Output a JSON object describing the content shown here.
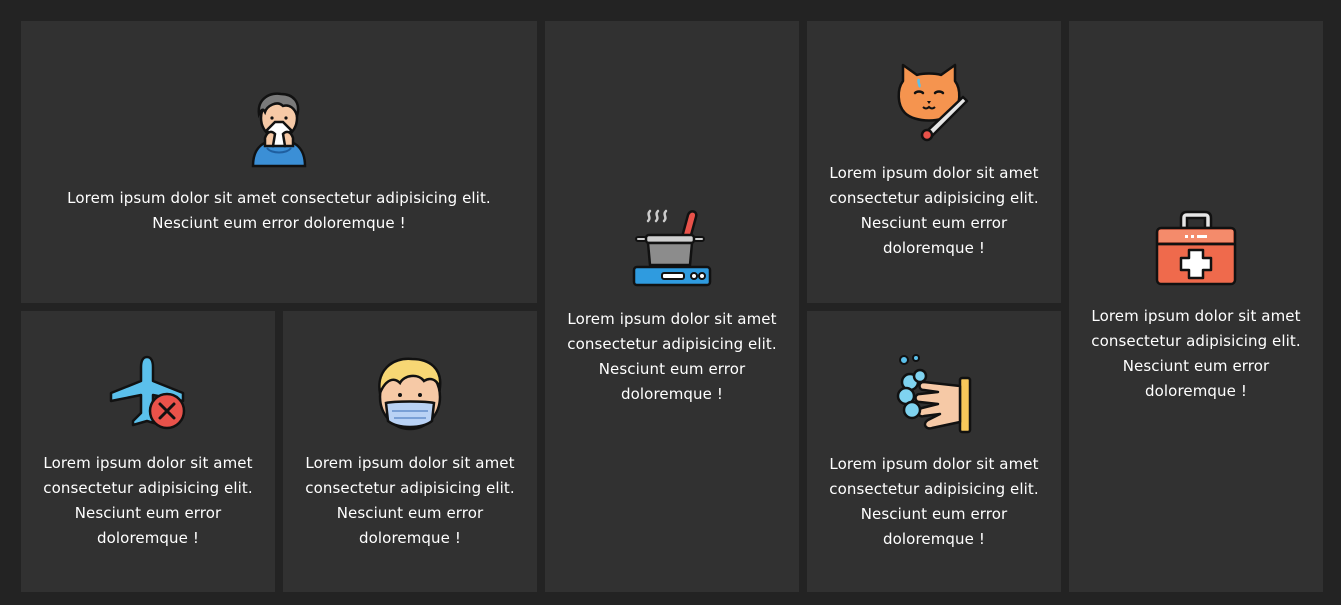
{
  "cards": [
    {
      "id": "sneeze",
      "icon": "sneezing-person-icon",
      "text": "Lorem ipsum dolor sit amet consectetur adipisicing elit. Nesciunt eum error doloremque !"
    },
    {
      "id": "plane",
      "icon": "cancelled-flight-icon",
      "text": "Lorem ipsum dolor sit amet consectetur adipisicing elit. Nesciunt eum error doloremque !"
    },
    {
      "id": "mask",
      "icon": "face-mask-person-icon",
      "text": "Lorem ipsum dolor sit amet consectetur adipisicing elit. Nesciunt eum error doloremque !"
    },
    {
      "id": "cook",
      "icon": "cooking-pot-stove-icon",
      "text": "Lorem ipsum dolor sit amet consectetur adipisicing elit. Nesciunt eum error doloremque !"
    },
    {
      "id": "cat",
      "icon": "sick-cat-thermometer-icon",
      "text": "Lorem ipsum dolor sit amet consectetur adipisicing elit. Nesciunt eum error doloremque !"
    },
    {
      "id": "wash",
      "icon": "hand-washing-icon",
      "text": "Lorem ipsum dolor sit amet consectetur adipisicing elit. Nesciunt eum error doloremque !"
    },
    {
      "id": "kit",
      "icon": "first-aid-kit-icon",
      "text": "Lorem ipsum dolor sit amet consectetur adipisicing elit. Nesciunt eum error doloremque !"
    }
  ],
  "colors": {
    "page_background": "#232323",
    "card_background": "#313131",
    "text": "#ffffff"
  }
}
